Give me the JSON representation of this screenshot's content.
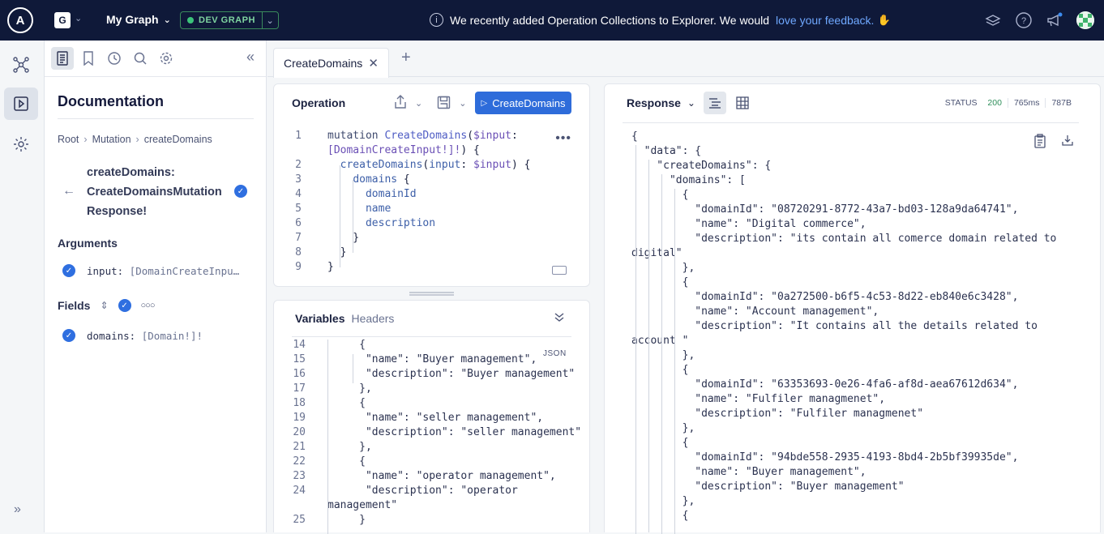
{
  "topbar": {
    "graph_badge": "G",
    "graph_name": "My Graph",
    "variant": "DEV GRAPH",
    "banner_text": "We recently added Operation Collections to Explorer. We would",
    "banner_link": "love your feedback.",
    "banner_emoji": "✋"
  },
  "docs": {
    "title": "Documentation",
    "breadcrumb": [
      "Root",
      "Mutation",
      "createDomains"
    ],
    "field_title_line1": "createDomains:",
    "field_title_line2": "CreateDomainsMutation",
    "field_title_line3": "Response!",
    "arguments_label": "Arguments",
    "arg_name": "input:",
    "arg_type": "[DomainCreateInpu…",
    "fields_label": "Fields",
    "field_name": "domains:",
    "field_type": "[Domain!]!"
  },
  "tabs": [
    {
      "label": "CreateDomains"
    }
  ],
  "operation": {
    "header": "Operation",
    "run_label": "CreateDomains",
    "lines": [
      {
        "n": "1",
        "html": "<span class='kw'>mutation</span> <span class='fn'>CreateDomains</span>(<span class='var'>$input</span>:"
      },
      {
        "n": "",
        "html": "<span class='ty'>[DomainCreateInput!]!</span>) {"
      },
      {
        "n": "2",
        "html": "  <span class='fld'>createDomains</span>(<span class='fld'>input</span>: <span class='var'>$input</span>) {"
      },
      {
        "n": "3",
        "html": "    <span class='fld'>domains</span> {"
      },
      {
        "n": "4",
        "html": "      <span class='fld'>domainId</span>"
      },
      {
        "n": "5",
        "html": "      <span class='fld'>name</span>"
      },
      {
        "n": "6",
        "html": "      <span class='fld'>description</span>"
      },
      {
        "n": "7",
        "html": "    }"
      },
      {
        "n": "8",
        "html": "  }"
      },
      {
        "n": "9",
        "html": "}"
      }
    ]
  },
  "variables": {
    "tab_active": "Variables",
    "tab_other": "Headers",
    "json_tag": "JSON",
    "lines": [
      {
        "n": "14",
        "t": "     {"
      },
      {
        "n": "15",
        "t": "      \"name\": \"Buyer management\","
      },
      {
        "n": "16",
        "t": "      \"description\": \"Buyer management\""
      },
      {
        "n": "17",
        "t": "     },"
      },
      {
        "n": "18",
        "t": "     {"
      },
      {
        "n": "19",
        "t": "      \"name\": \"seller management\","
      },
      {
        "n": "20",
        "t": "      \"description\": \"seller management\""
      },
      {
        "n": "21",
        "t": "     },"
      },
      {
        "n": "22",
        "t": "     {"
      },
      {
        "n": "23",
        "t": "      \"name\": \"operator management\","
      },
      {
        "n": "24",
        "t": "      \"description\": \"operator"
      },
      {
        "n": "",
        "t": "management\""
      },
      {
        "n": "25",
        "t": "     }"
      }
    ]
  },
  "response": {
    "header": "Response",
    "status_label": "STATUS",
    "status_code": "200",
    "time": "765ms",
    "size": "787B",
    "lines": [
      "{",
      "  \"data\": {",
      "    \"createDomains\": {",
      "      \"domains\": [",
      "        {",
      "          \"domainId\": \"08720291-8772-43a7-bd03-128a9da64741\",",
      "          \"name\": \"Digital commerce\",",
      "          \"description\": \"its contain all comerce domain related to",
      "digital\"",
      "        },",
      "        {",
      "          \"domainId\": \"0a272500-b6f5-4c53-8d22-eb840e6c3428\",",
      "          \"name\": \"Account management\",",
      "          \"description\": \"It contains all the details related to",
      "account \"",
      "        },",
      "        {",
      "          \"domainId\": \"63353693-0e26-4fa6-af8d-aea67612d634\",",
      "          \"name\": \"Fulfiler managmenet\",",
      "          \"description\": \"Fulfiler managmenet\"",
      "        },",
      "        {",
      "          \"domainId\": \"94bde558-2935-4193-8bd4-2b5bf39935de\",",
      "          \"name\": \"Buyer management\",",
      "          \"description\": \"Buyer management\"",
      "        },",
      "        {"
    ]
  },
  "colors": {
    "topbar": "#0f1939",
    "run_button": "#2e6cda",
    "check": "#2f6fe0",
    "status_ok": "#2f8f5b"
  }
}
